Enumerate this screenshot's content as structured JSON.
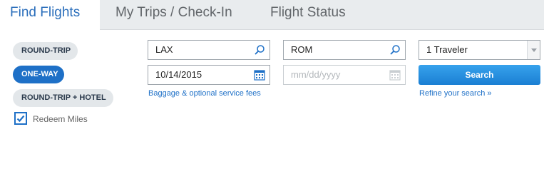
{
  "tabs": [
    {
      "label": "Find Flights",
      "active": true
    },
    {
      "label": "My Trips / Check-In",
      "active": false
    },
    {
      "label": "Flight Status",
      "active": false
    }
  ],
  "trip_types": [
    {
      "label": "ROUND-TRIP",
      "selected": false
    },
    {
      "label": "ONE-WAY",
      "selected": true
    },
    {
      "label": "ROUND-TRIP + HOTEL",
      "selected": false
    }
  ],
  "redeem": {
    "label": "Redeem Miles",
    "checked": true
  },
  "fields": {
    "from": {
      "value": "LAX",
      "icon": "search-icon"
    },
    "to": {
      "value": "ROM",
      "icon": "search-icon"
    },
    "depart": {
      "value": "10/14/2015",
      "icon": "calendar-icon"
    },
    "return": {
      "placeholder": "mm/dd/yyyy",
      "icon": "calendar-icon"
    }
  },
  "travelers": {
    "selected": "1 Traveler"
  },
  "search_button": "Search",
  "links": {
    "baggage": "Baggage & optional service fees",
    "refine": "Refine your search »"
  },
  "colors": {
    "accent": "#1e70c7",
    "search_button": "#2790e0",
    "tab_bar": "#e9ecee"
  }
}
